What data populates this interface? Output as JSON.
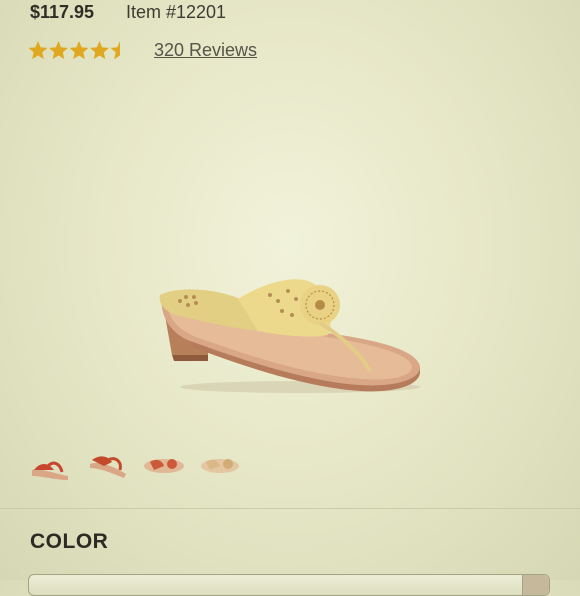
{
  "product": {
    "price": "$117.95",
    "item_number": "Item #12201",
    "rating": 4.5,
    "rating_max": 5,
    "reviews_label": "320 Reviews",
    "star_color": "#e0a820"
  },
  "gallery": {
    "main_image": "gold-flat-thong-sandal",
    "thumbnails": [
      {
        "name": "red-sandal-side-view",
        "color": "#c8452f"
      },
      {
        "name": "red-sandal-angle-view",
        "color": "#c34a2a"
      },
      {
        "name": "red-sandal-top-view",
        "color": "#cc5a3a"
      },
      {
        "name": "tan-sandal-view",
        "color": "#d9b889"
      }
    ]
  },
  "options": {
    "color_label": "COLOR",
    "color_selected": ""
  }
}
